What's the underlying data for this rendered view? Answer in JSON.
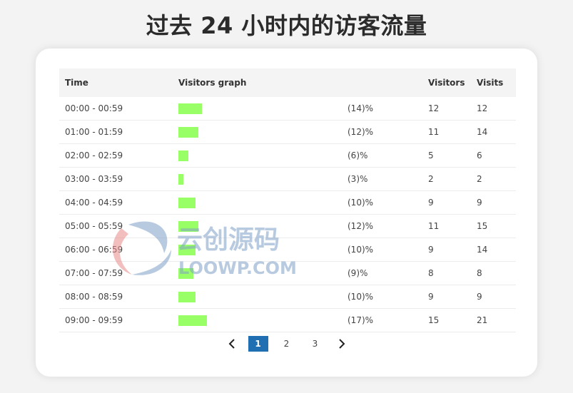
{
  "page": {
    "title": "过去 24 小时内的访客流量"
  },
  "table": {
    "headers": {
      "time": "Time",
      "graph": "Visitors graph",
      "visitors": "Visitors",
      "visits": "Visits"
    },
    "rows": [
      {
        "time": "00:00 - 00:59",
        "pct": "(14)%",
        "visitors": "12",
        "visits": "12",
        "share": 14
      },
      {
        "time": "01:00 - 01:59",
        "pct": "(12)%",
        "visitors": "11",
        "visits": "14",
        "share": 12
      },
      {
        "time": "02:00 - 02:59",
        "pct": "(6)%",
        "visitors": "5",
        "visits": "6",
        "share": 6
      },
      {
        "time": "03:00 - 03:59",
        "pct": "(3)%",
        "visitors": "2",
        "visits": "2",
        "share": 3
      },
      {
        "time": "04:00 - 04:59",
        "pct": "(10)%",
        "visitors": "9",
        "visits": "9",
        "share": 10
      },
      {
        "time": "05:00 - 05:59",
        "pct": "(12)%",
        "visitors": "11",
        "visits": "15",
        "share": 12
      },
      {
        "time": "06:00 - 06:59",
        "pct": "(10)%",
        "visitors": "9",
        "visits": "14",
        "share": 10
      },
      {
        "time": "07:00 - 07:59",
        "pct": "(9)%",
        "visitors": "8",
        "visits": "8",
        "share": 9
      },
      {
        "time": "08:00 - 08:59",
        "pct": "(10)%",
        "visitors": "9",
        "visits": "9",
        "share": 10
      },
      {
        "time": "09:00 - 09:59",
        "pct": "(17)%",
        "visitors": "15",
        "visits": "21",
        "share": 17
      }
    ],
    "bar_color": "#99ff66"
  },
  "pagination": {
    "prev": "‹",
    "next": "›",
    "pages": [
      "1",
      "2",
      "3"
    ],
    "active": "1",
    "active_color": "#1f6fb2"
  },
  "watermark": {
    "cn": "云创源码",
    "en": "LOOWP.COM"
  }
}
